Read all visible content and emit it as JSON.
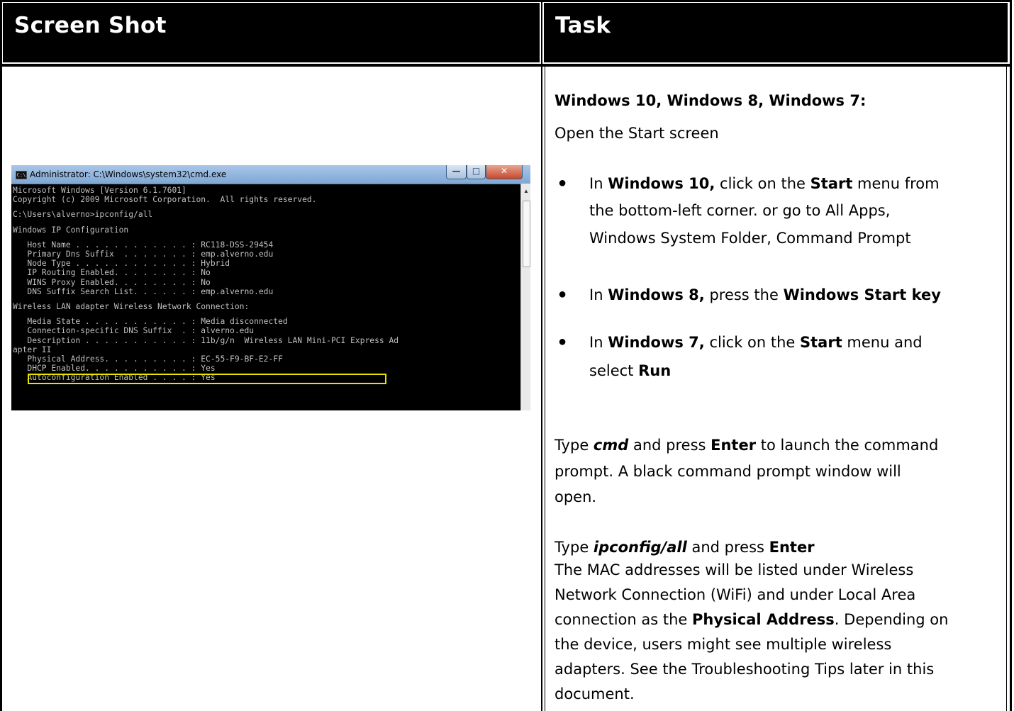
{
  "headers": {
    "left": "Screen Shot",
    "right": "Task"
  },
  "cmd_window": {
    "title": "Administrator: C:\\Windows\\system32\\cmd.exe",
    "icon_label": "C:\\",
    "lines": [
      "Microsoft Windows [Version 6.1.7601]",
      "Copyright (c) 2009 Microsoft Corporation.  All rights reserved.",
      "",
      "C:\\Users\\alverno>ipconfig/all",
      "",
      "Windows IP Configuration",
      "",
      "   Host Name . . . . . . . . . . . . : RC118-DSS-29454",
      "   Primary Dns Suffix  . . . . . . . : emp.alverno.edu",
      "   Node Type . . . . . . . . . . . . : Hybrid",
      "   IP Routing Enabled. . . . . . . . : No",
      "   WINS Proxy Enabled. . . . . . . . : No",
      "   DNS Suffix Search List. . . . . . : emp.alverno.edu",
      "",
      "Wireless LAN adapter Wireless Network Connection:",
      "",
      "   Media State . . . . . . . . . . . : Media disconnected",
      "   Connection-specific DNS Suffix  . : alverno.edu",
      "   Description . . . . . . . . . . . : 11b/g/n  Wireless LAN Mini-PCI Express Ad",
      "apter II",
      "   Physical Address. . . . . . . . . : EC-55-F9-BF-E2-FF",
      "   DHCP Enabled. . . . . . . . . . . : Yes",
      "   Autoconfiguration Enabled . . . . : Yes"
    ]
  },
  "task": {
    "heading": "Windows 10, Windows 8, Windows 7:",
    "open_start": "Open the Start screen",
    "b1": {
      "p1": "In ",
      "b1": "Windows 10,",
      "p2": " click on the ",
      "b2": "Start",
      "p3": " menu from",
      "l2": "the bottom-left corner. or go to All Apps,",
      "l3": "Windows System Folder, Command Prompt"
    },
    "b2": {
      "p1": "In ",
      "b1": "Windows 8,",
      "p2": " press the ",
      "b2": "Windows Start key"
    },
    "b3": {
      "p1": "In ",
      "b1": "Windows 7,",
      "p2": " click on the ",
      "b2": "Start",
      "p3": " menu and",
      "l2p": "select ",
      "l2b": "Run"
    },
    "cmd_para": {
      "p1": "Type ",
      "b1": "cmd",
      "p2": " and press ",
      "b2": "Enter",
      "p3": " to launch the command",
      "l2": "prompt.  A black command prompt window will",
      "l3": "open."
    },
    "ipconfig_para": {
      "p1": "Type ",
      "b1": "ipconfig/all",
      "p2": " and press ",
      "b2": "Enter",
      "l2": "The MAC addresses will be listed under Wireless",
      "l3": "Network Connection (WiFi) and under Local Area",
      "l4p": "connection as the ",
      "l4b": "Physical Address",
      "l4s": ". Depending on",
      "l5": "the device, users might see multiple wireless",
      "l6": "adapters.  See the Troubleshooting Tips later in this",
      "l7": "document."
    }
  }
}
